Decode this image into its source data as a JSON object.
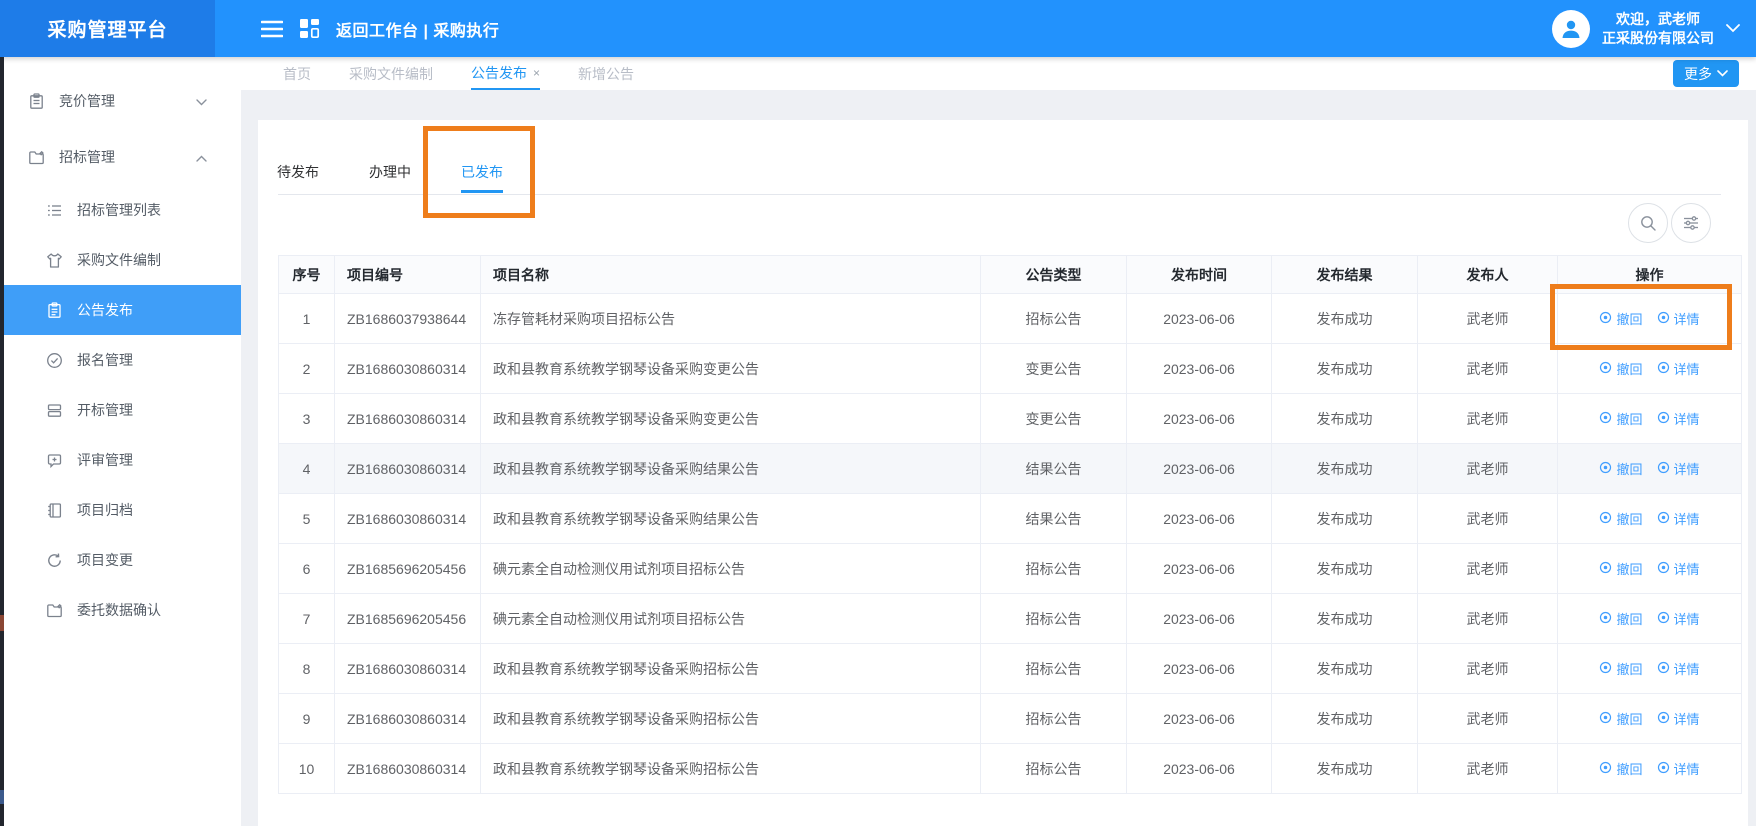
{
  "colors": {
    "accent": "#2196f3",
    "header": "#2292fd",
    "logo_bg": "#1e7ce8",
    "active_menu": "#3f9ef8",
    "link": "#409eff",
    "annotation": "#ee7d1b",
    "row_shaded": "#f5f7fa"
  },
  "header": {
    "logo": "采购管理平台",
    "workspace_title": "返回工作台 | 采购执行",
    "welcome_line1": "欢迎，武老师",
    "welcome_line2": "正采股份有限公司"
  },
  "tabbar": {
    "tabs": [
      {
        "label": "首页",
        "active": false
      },
      {
        "label": "采购文件编制",
        "active": false
      },
      {
        "label": "公告发布",
        "active": true,
        "close": "×"
      },
      {
        "label": "新增公告",
        "active": false
      }
    ],
    "more_label": "更多"
  },
  "sidebar": {
    "items": [
      {
        "label": "竞价管理",
        "icon": "clipboard-icon",
        "state": "collapsed"
      },
      {
        "label": "招标管理",
        "icon": "folder-pen-icon",
        "state": "expanded"
      }
    ],
    "sub_items": [
      {
        "label": "招标管理列表",
        "icon": "list-icon",
        "active": false
      },
      {
        "label": "采购文件编制",
        "icon": "shirt-icon",
        "active": false
      },
      {
        "label": "公告发布",
        "icon": "document-icon",
        "active": true
      },
      {
        "label": "报名管理",
        "icon": "check-circle-icon",
        "active": false
      },
      {
        "label": "开标管理",
        "icon": "stacked-panels-icon",
        "active": false
      },
      {
        "label": "评审管理",
        "icon": "comment-plus-icon",
        "active": false
      },
      {
        "label": "项目归档",
        "icon": "notebook-icon",
        "active": false
      },
      {
        "label": "项目变更",
        "icon": "refresh-icon",
        "active": false
      },
      {
        "label": "委托数据确认",
        "icon": "folder-pen-icon",
        "active": false
      }
    ]
  },
  "panel": {
    "tabs": [
      {
        "label": "待发布",
        "active": false
      },
      {
        "label": "办理中",
        "active": false
      },
      {
        "label": "已发布",
        "active": true
      }
    ],
    "tools": [
      "search-icon",
      "filter-icon"
    ]
  },
  "table": {
    "headers": [
      "序号",
      "项目编号",
      "项目名称",
      "公告类型",
      "发布时间",
      "发布结果",
      "发布人",
      "操作"
    ],
    "actions": [
      "撤回",
      "详情"
    ],
    "rows": [
      {
        "seq": "1",
        "code": "ZB1686037938644",
        "name": "冻存管耗材采购项目招标公告",
        "type": "招标公告",
        "time": "2023-06-06",
        "result": "发布成功",
        "publisher": "武老师"
      },
      {
        "seq": "2",
        "code": "ZB1686030860314",
        "name": "政和县教育系统教学钢琴设备采购变更公告",
        "type": "变更公告",
        "time": "2023-06-06",
        "result": "发布成功",
        "publisher": "武老师"
      },
      {
        "seq": "3",
        "code": "ZB1686030860314",
        "name": "政和县教育系统教学钢琴设备采购变更公告",
        "type": "变更公告",
        "time": "2023-06-06",
        "result": "发布成功",
        "publisher": "武老师"
      },
      {
        "seq": "4",
        "code": "ZB1686030860314",
        "name": "政和县教育系统教学钢琴设备采购结果公告",
        "type": "结果公告",
        "time": "2023-06-06",
        "result": "发布成功",
        "publisher": "武老师",
        "shaded": true
      },
      {
        "seq": "5",
        "code": "ZB1686030860314",
        "name": "政和县教育系统教学钢琴设备采购结果公告",
        "type": "结果公告",
        "time": "2023-06-06",
        "result": "发布成功",
        "publisher": "武老师"
      },
      {
        "seq": "6",
        "code": "ZB1685696205456",
        "name": "碘元素全自动检测仪用试剂项目招标公告",
        "type": "招标公告",
        "time": "2023-06-06",
        "result": "发布成功",
        "publisher": "武老师"
      },
      {
        "seq": "7",
        "code": "ZB1685696205456",
        "name": "碘元素全自动检测仪用试剂项目招标公告",
        "type": "招标公告",
        "time": "2023-06-06",
        "result": "发布成功",
        "publisher": "武老师"
      },
      {
        "seq": "8",
        "code": "ZB1686030860314",
        "name": "政和县教育系统教学钢琴设备采购招标公告",
        "type": "招标公告",
        "time": "2023-06-06",
        "result": "发布成功",
        "publisher": "武老师"
      },
      {
        "seq": "9",
        "code": "ZB1686030860314",
        "name": "政和县教育系统教学钢琴设备采购招标公告",
        "type": "招标公告",
        "time": "2023-06-06",
        "result": "发布成功",
        "publisher": "武老师"
      },
      {
        "seq": "10",
        "code": "ZB1686030860314",
        "name": "政和县教育系统教学钢琴设备采购招标公告",
        "type": "招标公告",
        "time": "2023-06-06",
        "result": "发布成功",
        "publisher": "武老师"
      }
    ]
  }
}
